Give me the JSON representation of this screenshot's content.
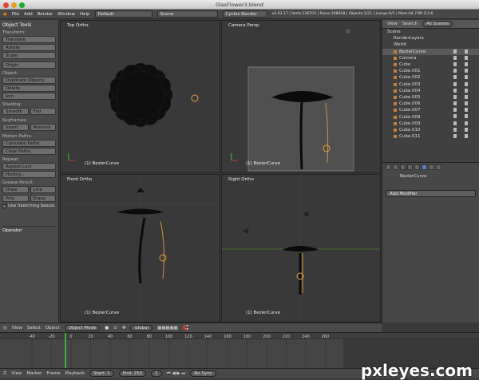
{
  "window": {
    "title": "GlasFlower3.blend"
  },
  "menubar": {
    "items": [
      "File",
      "Add",
      "Render",
      "Window",
      "Help"
    ],
    "layout": "Default",
    "scene": "Scene",
    "engine": "Cycles Render",
    "stats": "v2.63.17 | Verts:136703 | Faces:108928 | Objects:1/21 | Lamps:0/1 | Mem:44.73M (13.6"
  },
  "toolshelf": {
    "title": "Object Tools",
    "transform_label": "Transform:",
    "translate": "Translate",
    "rotate": "Rotate",
    "scale": "Scale",
    "origin": "Origin",
    "object_label": "Object:",
    "duplicate": "Duplicate Objects",
    "delete": "Delete",
    "join": "Join",
    "shading_label": "Shading:",
    "smooth": "Smooth",
    "flat": "Flat",
    "keyframes_label": "Keyframes:",
    "insert": "Insert",
    "remove": "Remove",
    "motion_label": "Motion Paths:",
    "calc_paths": "Calculate Paths",
    "clear_paths": "Clear Paths",
    "repeat_label": "Repeat:",
    "repeat_last": "Repeat Last",
    "history": "History...",
    "grease_label": "Grease Pencil:",
    "draw": "Draw",
    "line": "Line",
    "poly": "Poly",
    "erase": "Erase",
    "sketching": "Use Sketching Sessio",
    "operator": "Operator"
  },
  "viewports": {
    "top": {
      "label": "Top Ortho",
      "object": "(1) BezierCurve"
    },
    "camera": {
      "label": "Camera Persp",
      "object": "(1) BezierCurve"
    },
    "front": {
      "label": "Front Ortho",
      "object": "(1) BezierCurve"
    },
    "right": {
      "label": "Right Ortho",
      "object": "(1) BezierCurve"
    }
  },
  "outliner": {
    "view": "View",
    "search": "Search",
    "filter": "All Scenes",
    "items": [
      "Scene",
      "RenderLayers",
      "World",
      "BezierCurve",
      "Camera",
      "Cube",
      "Cube.001",
      "Cube.002",
      "Cube.003",
      "Cube.004",
      "Cube.005",
      "Cube.006",
      "Cube.007",
      "Cube.008",
      "Cube.009",
      "Cube.010",
      "Cube.011"
    ]
  },
  "properties": {
    "object": "BezierCurve",
    "add_modifier": "Add Modifier"
  },
  "view3d_header": {
    "view": "View",
    "select": "Select",
    "object": "Object",
    "mode": "Object Mode",
    "orientation": "Global"
  },
  "timeline": {
    "ticks": [
      "-40",
      "-20",
      "0",
      "20",
      "40",
      "60",
      "80",
      "100",
      "120",
      "140",
      "160",
      "180",
      "200",
      "220",
      "240",
      "260"
    ],
    "view": "View",
    "marker": "Marker",
    "frame": "Frame",
    "playback": "Playback",
    "start": "Start: 1",
    "end": "End: 250",
    "current": "1",
    "sync": "No Sync"
  },
  "watermark": "pxleyes.com"
}
